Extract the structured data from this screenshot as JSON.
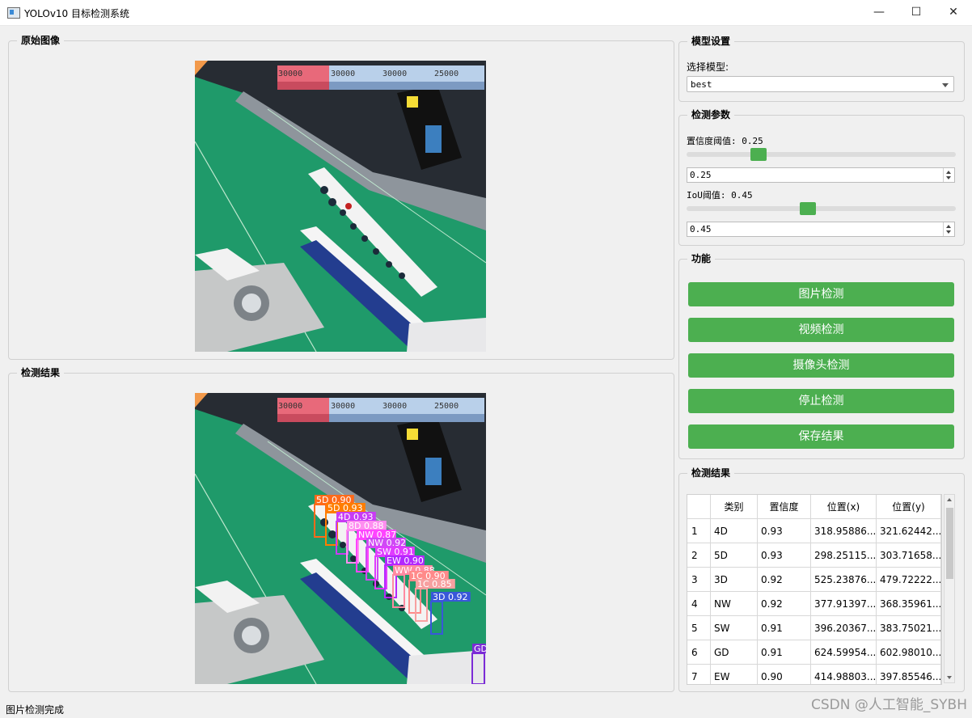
{
  "window": {
    "title": "YOLOv10 目标检测系统"
  },
  "left": {
    "original_title": "原始图像",
    "result_title": "检测结果"
  },
  "score_labels": [
    "30000",
    "30000",
    "30000",
    "25000"
  ],
  "detections_overlay": [
    {
      "text": "5D 0.90",
      "color": "#ff6a1a"
    },
    {
      "text": "5D 0.93",
      "color": "#ff7d00"
    },
    {
      "text": "4D 0.93",
      "color": "#c83cf5"
    },
    {
      "text": "8D 0.88",
      "color": "#ff8ef0"
    },
    {
      "text": "NW 0.87",
      "color": "#ff44ff"
    },
    {
      "text": "NW 0.92",
      "color": "#d049f5"
    },
    {
      "text": "SW 0.91",
      "color": "#e03cff"
    },
    {
      "text": "EW 0.90",
      "color": "#b428ff"
    },
    {
      "text": "WW 0.88",
      "color": "#ff8aa2"
    },
    {
      "text": "1C 0.90",
      "color": "#ff8a8a"
    },
    {
      "text": "1C 0.85",
      "color": "#f7a0a0"
    },
    {
      "text": "3D 0.92",
      "color": "#3957d9"
    },
    {
      "text": "GD",
      "color": "#7b2bd6"
    }
  ],
  "model_settings": {
    "title": "模型设置",
    "label": "选择模型:",
    "selected": "best"
  },
  "detect_params": {
    "title": "检测参数",
    "conf_label": "置信度阈值: 0.25",
    "conf_value": "0.25",
    "conf_fraction": 0.25,
    "iou_label": "IoU阈值: 0.45",
    "iou_value": "0.45",
    "iou_fraction": 0.45
  },
  "functions": {
    "title": "功能",
    "buttons": [
      "图片检测",
      "视频检测",
      "摄像头检测",
      "停止检测",
      "保存结果"
    ]
  },
  "results": {
    "title": "检测结果",
    "headers": [
      "类别",
      "置信度",
      "位置(x)",
      "位置(y)"
    ],
    "rows": [
      [
        "1",
        "4D",
        "0.93",
        "318.95886...",
        "321.62442..."
      ],
      [
        "2",
        "5D",
        "0.93",
        "298.25115...",
        "303.71658..."
      ],
      [
        "3",
        "3D",
        "0.92",
        "525.23876...",
        "479.72222..."
      ],
      [
        "4",
        "NW",
        "0.92",
        "377.91397...",
        "368.35961..."
      ],
      [
        "5",
        "SW",
        "0.91",
        "396.20367...",
        "383.75021..."
      ],
      [
        "6",
        "GD",
        "0.91",
        "624.59954...",
        "602.98010..."
      ],
      [
        "7",
        "EW",
        "0.90",
        "414.98803...",
        "397.85546..."
      ]
    ]
  },
  "status": "图片检测完成",
  "watermark": "CSDN @人工智能_SYBH",
  "colors": {
    "accent": "#4caf50",
    "felt": "#1f9a6a"
  }
}
